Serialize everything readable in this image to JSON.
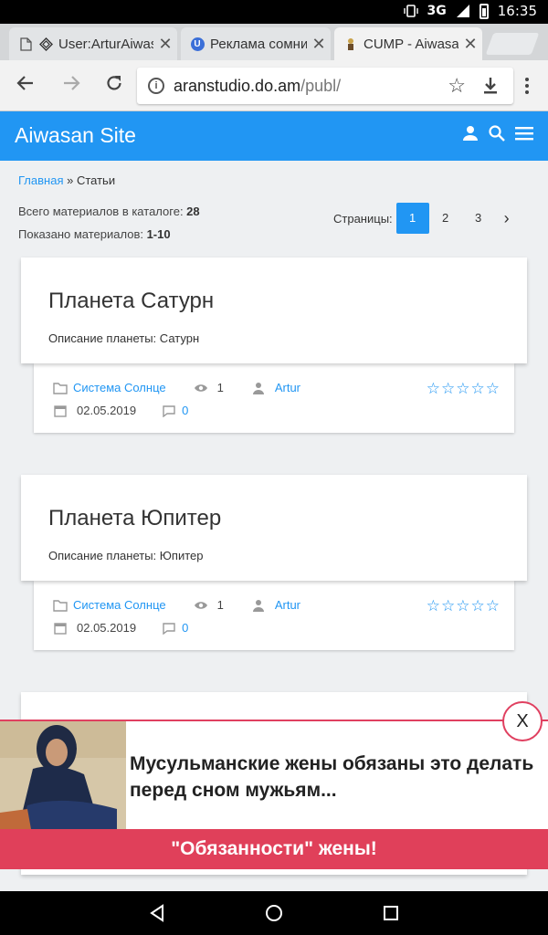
{
  "status_bar": {
    "network": "3G",
    "time": "16:35"
  },
  "tabs": [
    {
      "title": "User:ArturAiwas",
      "icon": "page-icon"
    },
    {
      "title": "Реклама сомни",
      "icon": "u-badge-icon"
    },
    {
      "title": "CUMP - Aiwasan",
      "icon": "site-favicon-icon",
      "active": true
    }
  ],
  "urlbar": {
    "domain": "aranstudio.do.am",
    "path": "/publ/"
  },
  "header": {
    "site_title": "Aiwasan Site"
  },
  "breadcrumb": {
    "home": "Главная",
    "separator": " » ",
    "current": "Статьи"
  },
  "totals": {
    "total_label": "Всего материалов в каталоге: ",
    "total_value": "28",
    "shown_label": "Показано материалов: ",
    "shown_value": "1-10"
  },
  "pagination": {
    "label": "Страницы:",
    "pages": [
      "1",
      "2",
      "3"
    ],
    "current": "1",
    "next": "›"
  },
  "articles": [
    {
      "title": "Планета Сатурн",
      "description": "Описание планеты: Сатурн",
      "category": "Система Солнце",
      "views": "1",
      "author": "Artur",
      "date": "02.05.2019",
      "comments": "0",
      "rating": 0
    },
    {
      "title": "Планета Юпитер",
      "description": "Описание планеты: Юпитер",
      "category": "Система Солнце",
      "views": "1",
      "author": "Artur",
      "date": "02.05.2019",
      "comments": "0",
      "rating": 0
    }
  ],
  "ad": {
    "headline": "Мусульманские жены обязаны это делать перед сном мужьям...",
    "cta": "\"Обязанности\" жены!",
    "close": "X"
  },
  "colors": {
    "accent": "#2196f3",
    "ad_red": "#e0405a"
  }
}
